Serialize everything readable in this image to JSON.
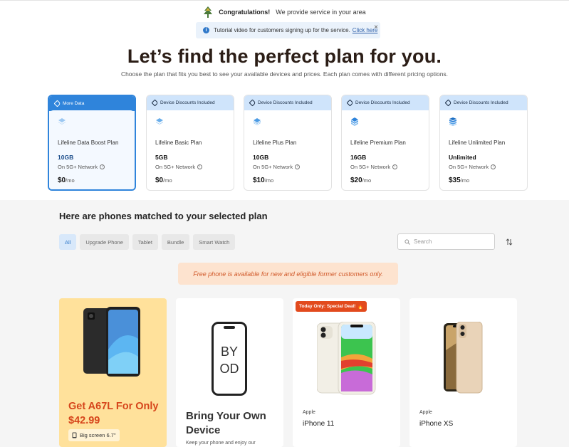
{
  "banner": {
    "congrats_title": "Congratulations!",
    "congrats_msg": "We provide service in your area"
  },
  "tutorial": {
    "text": "Tutorial video for customers signing up for the service.",
    "link": "Click here",
    "close": "×"
  },
  "hero": {
    "title": "Let’s find the perfect plan for you.",
    "subtitle": "Choose the plan that fits you best to see your available devices and prices. Each plan comes with different pricing options."
  },
  "plans": [
    {
      "tag": "More Data",
      "name": "Lifeline Data Boost Plan",
      "data": "10GB",
      "network": "On 5G+ Network",
      "price": "$0",
      "per": "/mo"
    },
    {
      "tag": "Device Discounts Included",
      "name": "Lifeline Basic Plan",
      "data": "5GB",
      "network": "On 5G+ Network",
      "price": "$0",
      "per": "/mo"
    },
    {
      "tag": "Device Discounts Included",
      "name": "Lifeline Plus Plan",
      "data": "10GB",
      "network": "On 5G+ Network",
      "price": "$10",
      "per": "/mo"
    },
    {
      "tag": "Device Discounts Included",
      "name": "Lifeline Premium Plan",
      "data": "16GB",
      "network": "On 5G+ Network",
      "price": "$20",
      "per": "/mo"
    },
    {
      "tag": "Device Discounts Included",
      "name": "Lifeline Unlimited Plan",
      "data": "Unlimited",
      "network": "On 5G+ Network",
      "price": "$35",
      "per": "/mo"
    }
  ],
  "phones_section": {
    "title": "Here are phones matched to your selected plan",
    "filters": [
      "All",
      "Upgrade Phone",
      "Tablet",
      "Bundle",
      "Smart Watch"
    ],
    "search_placeholder": "Search",
    "notice": "Free phone is available for new and eligible former customers only."
  },
  "cards": {
    "promo": {
      "title": "Get A67L For Only $42.99",
      "badge": "Big screen 6.7\""
    },
    "byod": {
      "screen_line1": "BY",
      "screen_line2": "OD",
      "title": "Bring Your Own Device",
      "subtitle": "Keep your phone and enjoy our"
    },
    "iphone11": {
      "deal": "Today Only: Special Deal!",
      "brand": "Apple",
      "name": "iPhone 11"
    },
    "iphonexs": {
      "brand": "Apple",
      "name": "iPhone XS"
    }
  },
  "colors": {
    "accent_blue": "#2f84db",
    "promo_bg": "#ffe19b",
    "promo_text": "#d6451b",
    "notice_bg": "#fde3cf",
    "headline": "#2b1d16"
  }
}
